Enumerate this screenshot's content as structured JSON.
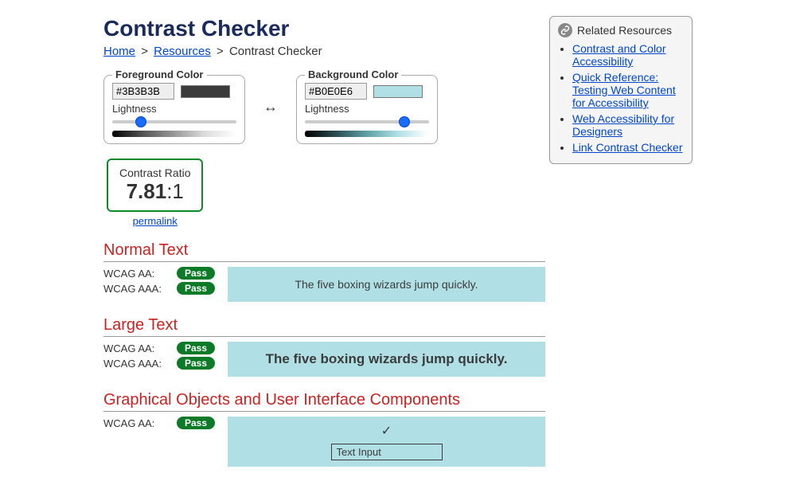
{
  "title": "Contrast Checker",
  "breadcrumb": {
    "home": "Home",
    "resources": "Resources",
    "current": "Contrast Checker"
  },
  "foreground": {
    "legend": "Foreground Color",
    "value": "#3B3B3B",
    "lightness_label": "Lightness",
    "lightness_pct": 23
  },
  "background": {
    "legend": "Background Color",
    "value": "#B0E0E6",
    "lightness_label": "Lightness",
    "lightness_pct": 80
  },
  "swap_symbol": "↔",
  "ratio": {
    "label": "Contrast Ratio",
    "value": "7.81",
    "suffix": ":1",
    "permalink": "permalink"
  },
  "sections": {
    "normal": {
      "title": "Normal Text",
      "aa_label": "WCAG AA:",
      "aa_result": "Pass",
      "aaa_label": "WCAG AAA:",
      "aaa_result": "Pass",
      "sample": "The five boxing wizards jump quickly."
    },
    "large": {
      "title": "Large Text",
      "aa_label": "WCAG AA:",
      "aa_result": "Pass",
      "aaa_label": "WCAG AAA:",
      "aaa_result": "Pass",
      "sample": "The five boxing wizards jump quickly."
    },
    "gui": {
      "title": "Graphical Objects and User Interface Components",
      "aa_label": "WCAG AA:",
      "aa_result": "Pass",
      "input_value": "Text Input",
      "check": "✓"
    }
  },
  "sidebar": {
    "title": "Related Resources",
    "items": [
      "Contrast and Color Accessibility",
      "Quick Reference: Testing Web Content for Accessibility",
      "Web Accessibility for Designers",
      "Link Contrast Checker"
    ]
  }
}
